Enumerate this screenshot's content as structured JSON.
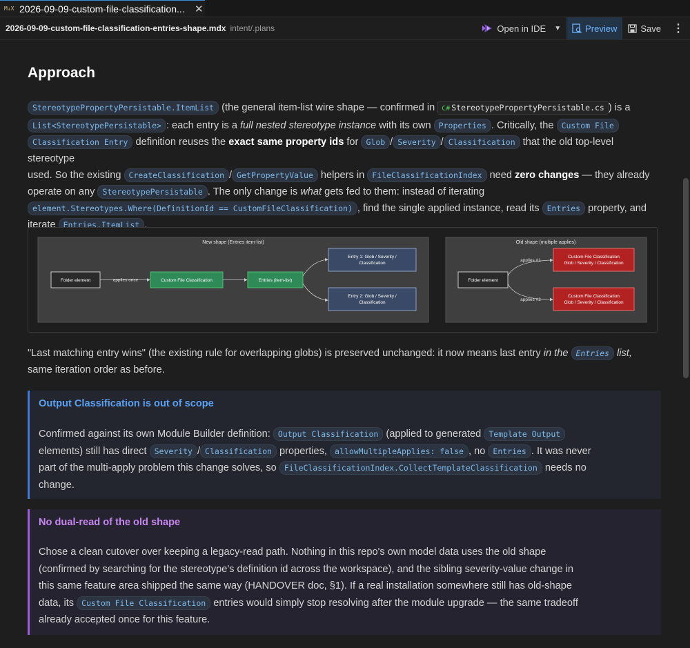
{
  "tab": {
    "badge": "M↓X",
    "title": "2026-09-09-custom-file-classification...",
    "close": "✕"
  },
  "toolbar": {
    "filename": "2026-09-09-custom-file-classification-entries-shape.mdx",
    "path": "intent/.plans",
    "open_in_ide": "Open in IDE",
    "preview": "Preview",
    "save": "Save",
    "more": "⋮"
  },
  "doc": {
    "heading": "Approach",
    "p1": {
      "c1": "StereotypePropertyPersistable.ItemList",
      "t1": " (the general item-list wire shape — confirmed in ",
      "cs_badge": "C#",
      "cs_file": "StereotypePropertyPersistable.cs",
      "t2": ") is a",
      "c2": "List<StereotypePersistable>",
      "t3": ": each entry is a ",
      "e1": "full nested stereotype instance",
      "t4": " with its own ",
      "c3": "Properties",
      "t5": ". Critically, the ",
      "c4a": "Custom File",
      "c4b": "Classification Entry",
      "t6": " definition reuses the ",
      "b1": "exact same property ids",
      "t7": " for ",
      "c5": "Glob",
      "c6": "Severity",
      "c7": "Classification",
      "t8": " that the old top-level stereotype",
      "t9": "used. So the existing ",
      "c8": "CreateClassification",
      "c9": "GetPropertyValue",
      "t10": " helpers in ",
      "c10": "FileClassificationIndex",
      "t11": " need ",
      "b2": "zero changes",
      "t12": " — they already",
      "t13": "operate on any ",
      "c11": "StereotypePersistable",
      "t14": ". The only change is ",
      "e2": "what",
      "t15": " gets fed to them: instead of iterating",
      "c12": "element.Stereotypes.Where(DefinitionId == CustomFileClassification)",
      "t16": ", find the single applied instance, read its ",
      "c13": "Entries",
      "t17": " property, and",
      "t18": "iterate ",
      "c14": "Entries.ItemList",
      "t19": "."
    },
    "p2": {
      "t1": "\"Last matching entry wins\" (the existing rule for overlapping globs) is preserved unchanged: it now means last entry ",
      "e1": "in the",
      "c1": "Entries",
      "t2": " list,",
      "t3": "same iteration order as before."
    },
    "separator": "/",
    "comma": ", ",
    "space": " "
  },
  "diagram_new": {
    "title": "New shape (Entries item-list)",
    "folder": "Folder element",
    "edge1": "applies once",
    "cfc": "Custom File Classification",
    "entries": "Entries (item-list)",
    "entry1a": "Entry 1: Glob / Severity /",
    "entry1b": "Classification",
    "entry2a": "Entry 2: Glob / Severity /",
    "entry2b": "Classification"
  },
  "diagram_old": {
    "title": "Old shape (multiple applies)",
    "folder": "Folder element",
    "edge1": "applies #1",
    "edge2": "applies #2",
    "cfc1a": "Custom File Classification",
    "cfc1b": "Glob / Severity / Classification",
    "cfc2a": "Custom File Classification",
    "cfc2b": "Glob / Severity / Classification"
  },
  "callout1": {
    "title": "Output Classification is out of scope",
    "t1": "Confirmed against its own Module Builder definition: ",
    "c1": "Output Classification",
    "t2": " (applied to generated ",
    "c2": "Template Output",
    "t3": "elements) still has direct ",
    "c3": "Severity",
    "c4": "Classification",
    "t4": " properties, ",
    "c5": "allowMultipleApplies: false",
    "t5": ", no ",
    "c6": "Entries",
    "t6": ". It was never",
    "t7": "part of the multi-apply problem this change solves, so ",
    "c7": "FileClassificationIndex.CollectTemplateClassification",
    "t8": " needs no",
    "t9": "change."
  },
  "callout2": {
    "title": "No dual-read of the old shape",
    "l1": "Chose a clean cutover over keeping a legacy-read path. Nothing in this repo's own model data uses the old shape",
    "l2": "(confirmed by searching for the stereotype's definition id across the workspace), and the sibling severity-value change in",
    "l3": "this same feature area shipped the same way (HANDOVER doc, §1). If a real installation somewhere still has old-shape",
    "l4a": "data, its ",
    "c1": "Custom File Classification",
    "l4b": " entries would simply stop resolving after the module upgrade — the same tradeoff",
    "l5": "already accepted once for this feature."
  },
  "colors": {
    "accent": "#3c8fd6",
    "blue_callout": "#5aa0f0",
    "purple_callout": "#c586f0",
    "green_node": "#2e8b57",
    "red_node": "#b22222"
  }
}
